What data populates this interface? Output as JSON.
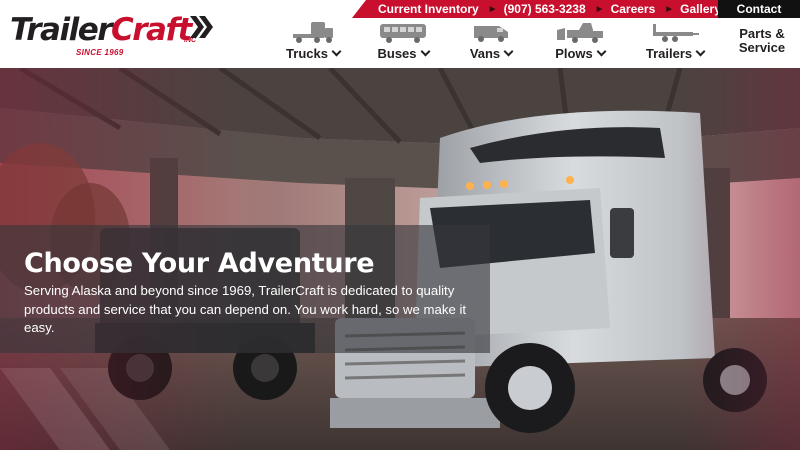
{
  "brand": {
    "logo_part1": "Trailer",
    "logo_part2": "Craft",
    "since": "SINCE 1969",
    "inc": "INC"
  },
  "topbar": {
    "items": [
      "Current Inventory",
      "(907) 563-3238",
      "Careers",
      "Gallery"
    ],
    "contact": "Contact"
  },
  "nav": {
    "items": [
      {
        "label": "Trucks",
        "icon": "truck-icon"
      },
      {
        "label": "Buses",
        "icon": "bus-icon"
      },
      {
        "label": "Vans",
        "icon": "van-icon"
      },
      {
        "label": "Plows",
        "icon": "plow-icon"
      },
      {
        "label": "Trailers",
        "icon": "trailer-icon"
      }
    ],
    "parts_line1": "Parts &",
    "parts_line2": "Service"
  },
  "hero": {
    "headline": "Choose Your Adventure",
    "body": "Serving Alaska and beyond since 1969, TrailerCraft is dedicated to quality products and service that you can depend on. You work hard, so we make it easy."
  },
  "colors": {
    "brand_red": "#c8102e",
    "dark": "#231f20"
  }
}
